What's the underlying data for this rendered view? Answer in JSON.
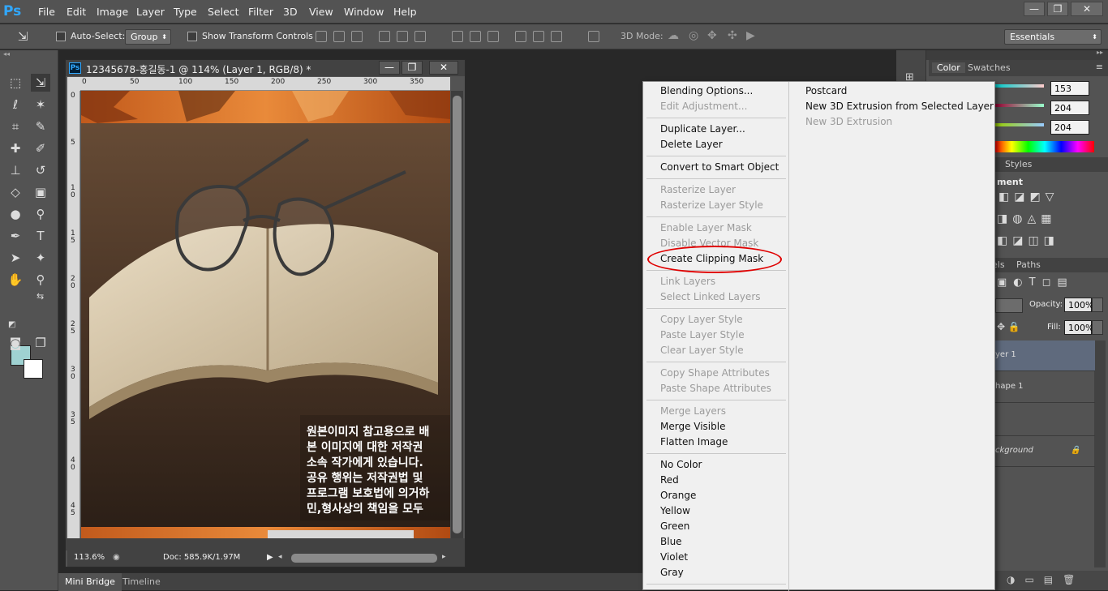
{
  "app": {
    "logo": "Ps"
  },
  "menubar": {
    "items": [
      "File",
      "Edit",
      "Image",
      "Layer",
      "Type",
      "Select",
      "Filter",
      "3D",
      "View",
      "Window",
      "Help"
    ]
  },
  "window_controls": {
    "minimize": "—",
    "restore": "❐",
    "close": "✕"
  },
  "options": {
    "auto_select_label": "Auto-Select:",
    "auto_select_value": "Group",
    "transform_label": "Show Transform Controls",
    "mode3d_label": "3D Mode:",
    "workspace": "Essentials"
  },
  "document": {
    "title": "12345678-홍길동-1 @ 114% (Layer 1, RGB/8) *",
    "ps_badge": "Ps",
    "zoom": "113.6%",
    "doc_info": "Doc: 585.9K/1.97M",
    "ruler_h": [
      "0",
      "50",
      "100",
      "150",
      "200",
      "250",
      "300",
      "350"
    ],
    "ruler_v": [
      "0",
      "5",
      "1\n0",
      "1\n5",
      "2\n0",
      "2\n5",
      "3\n0",
      "3\n5",
      "4\n0",
      "4\n5"
    ],
    "overlay_text": [
      "원본이미지 참고용으로 배",
      "본 이미지에 대한 저작권",
      "소속 작가에게 있습니다.",
      "공유 행위는 저작권법 및",
      "프로그램 보호법에 의거하",
      "민,형사상의 책임을 모두"
    ]
  },
  "right_panel": {
    "tabs": [
      "Color",
      "Swatches"
    ],
    "values": [
      "153",
      "204",
      "204"
    ],
    "styles_tab": "Styles",
    "adjust_label": "ment",
    "layers_tabs": [
      "els",
      "Paths"
    ],
    "opacity_label": "Opacity:",
    "opacity_value": "100%",
    "fill_label": "Fill:",
    "fill_value": "100%",
    "layers": [
      "yer 1",
      "hape 1",
      "ckground"
    ]
  },
  "context_menu": {
    "main": [
      {
        "label": "Blending Options...",
        "enabled": true
      },
      {
        "label": "Edit Adjustment...",
        "enabled": false
      },
      {
        "label": "Duplicate Layer...",
        "enabled": true
      },
      {
        "label": "Delete Layer",
        "enabled": true
      },
      {
        "label": "Convert to Smart Object",
        "enabled": true
      },
      {
        "label": "Rasterize Layer",
        "enabled": false
      },
      {
        "label": "Rasterize Layer Style",
        "enabled": false
      },
      {
        "label": "Enable Layer Mask",
        "enabled": false
      },
      {
        "label": "Disable Vector Mask",
        "enabled": false
      },
      {
        "label": "Create Clipping Mask",
        "enabled": true
      },
      {
        "label": "Link Layers",
        "enabled": false
      },
      {
        "label": "Select Linked Layers",
        "enabled": false
      },
      {
        "label": "Copy Layer Style",
        "enabled": false
      },
      {
        "label": "Paste Layer Style",
        "enabled": false
      },
      {
        "label": "Clear Layer Style",
        "enabled": false
      },
      {
        "label": "Copy Shape Attributes",
        "enabled": false
      },
      {
        "label": "Paste Shape Attributes",
        "enabled": false
      },
      {
        "label": "Merge Layers",
        "enabled": false
      },
      {
        "label": "Merge Visible",
        "enabled": true
      },
      {
        "label": "Flatten Image",
        "enabled": true
      },
      {
        "label": "No Color",
        "enabled": true
      },
      {
        "label": "Red",
        "enabled": true
      },
      {
        "label": "Orange",
        "enabled": true
      },
      {
        "label": "Yellow",
        "enabled": true
      },
      {
        "label": "Green",
        "enabled": true
      },
      {
        "label": "Blue",
        "enabled": true
      },
      {
        "label": "Violet",
        "enabled": true
      },
      {
        "label": "Gray",
        "enabled": true
      }
    ],
    "sub": [
      {
        "label": "Postcard",
        "enabled": true
      },
      {
        "label": "New 3D Extrusion from Selected Layer",
        "enabled": true
      },
      {
        "label": "New 3D Extrusion",
        "enabled": false
      }
    ]
  },
  "bottom_tabs": [
    "Mini Bridge",
    "Timeline"
  ],
  "colors": {
    "accent": "#31a8ff",
    "highlight": "#e00000",
    "foreground": "#9fd2d2",
    "background": "#ffffff"
  }
}
